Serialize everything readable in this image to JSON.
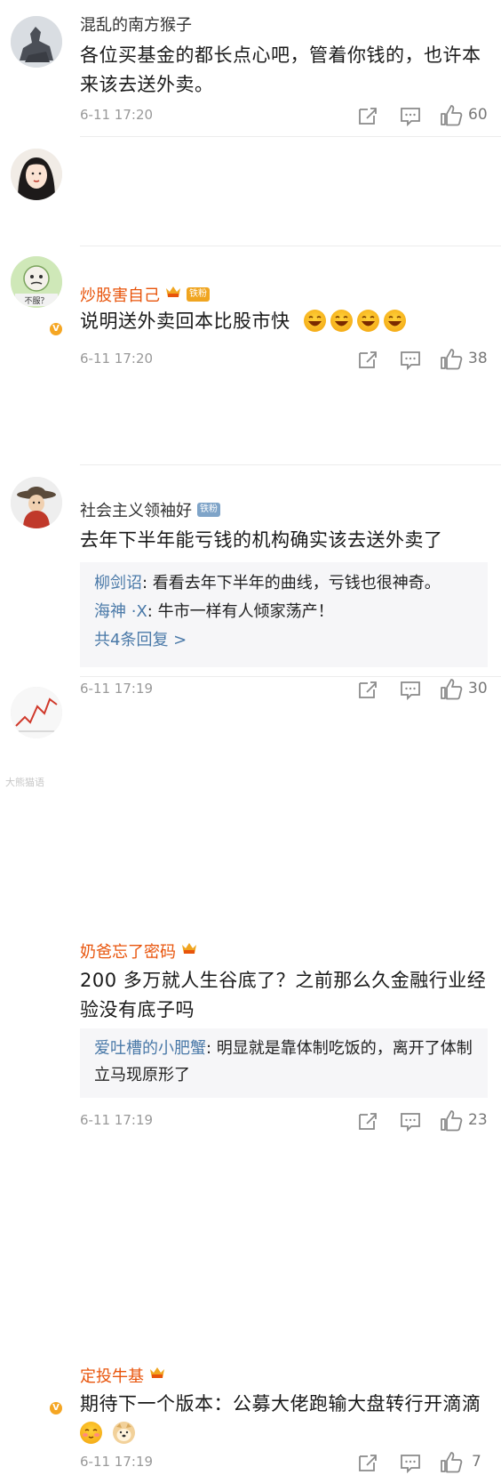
{
  "comments": [
    {
      "user": "混乱的南方猴子",
      "text": "各位买基金的都长点心吧，管着你钱的，也许本来该去送外卖。",
      "time": "6-11 17:20",
      "likes": "60"
    },
    {
      "user": "炒股害自己",
      "badge": "铁粉",
      "text": "说明送外卖回本比股市快",
      "time": "6-11 17:20",
      "likes": "38"
    },
    {
      "user": "社会主义领袖好",
      "badge": "铁粉",
      "avatar_text": "不服？",
      "text": "去年下半年能亏钱的机构确实该去送外卖了",
      "replies": [
        {
          "name": "柳剑诏",
          "text": ": 看看去年下半年的曲线，亏钱也很神奇。"
        },
        {
          "name": "海神 ·X",
          "text": ": 牛市一样有人倾家荡产！"
        }
      ],
      "more": "共4条回复 >",
      "time": "6-11 17:19",
      "likes": "30"
    },
    {
      "user": "奶爸忘了密码",
      "text": "200 多万就人生谷底了？之前那么久金融行业经验没有底子吗",
      "replies": [
        {
          "name": "爱吐槽的小肥蟹",
          "text": ": 明显就是靠体制吃饭的，离开了体制立马现原形了"
        }
      ],
      "time": "6-11 17:19",
      "likes": "23"
    },
    {
      "user": "定投牛基",
      "text": "期待下一个版本：公募大佬跑输大盘转行开滴滴",
      "time": "6-11 17:19",
      "likes": "7"
    }
  ],
  "watermark": "大熊猫语",
  "colors": {
    "orange_name": "#e8540b",
    "link_blue": "#4a79a8",
    "reply_bg": "#f6f6f8",
    "meta_grey": "#999999"
  },
  "icons": [
    "share-icon",
    "comment-icon",
    "like-icon",
    "verified-badge-icon",
    "crown-icon",
    "laugh-emoji-icon",
    "blush-emoji-icon",
    "doge-emoji-icon"
  ]
}
